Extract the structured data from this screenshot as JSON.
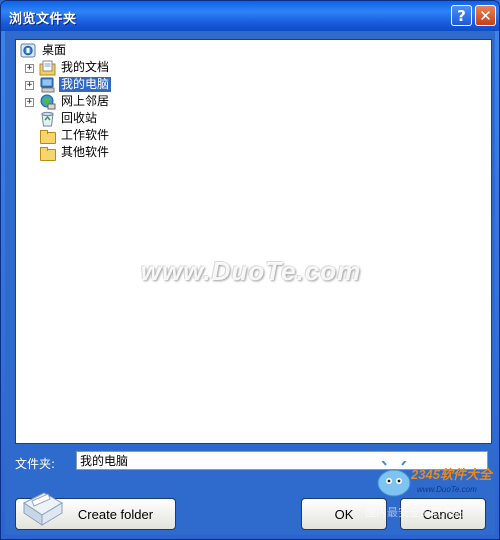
{
  "window": {
    "title": "浏览文件夹"
  },
  "titlebar": {
    "help_label": "?",
    "close_label": "✕"
  },
  "tree": {
    "items": [
      {
        "label": "桌面",
        "icon": "desktop-icon",
        "level": 0,
        "expandable": false,
        "selected": false
      },
      {
        "label": "我的文档",
        "icon": "documents-folder-icon",
        "level": 1,
        "expandable": true,
        "selected": false
      },
      {
        "label": "我的电脑",
        "icon": "computer-icon",
        "level": 1,
        "expandable": true,
        "selected": true
      },
      {
        "label": "网上邻居",
        "icon": "network-icon",
        "level": 1,
        "expandable": true,
        "selected": false
      },
      {
        "label": "回收站",
        "icon": "recycle-bin-icon",
        "level": 1,
        "expandable": false,
        "selected": false
      },
      {
        "label": "工作软件",
        "icon": "folder-icon",
        "level": 1,
        "expandable": false,
        "selected": false
      },
      {
        "label": "其他软件",
        "icon": "folder-icon",
        "level": 1,
        "expandable": false,
        "selected": false
      }
    ]
  },
  "path": {
    "label": "文件夹:",
    "value": "我的电脑"
  },
  "buttons": {
    "create_folder": "Create folder",
    "ok": "OK",
    "cancel": "Cancel"
  },
  "watermark": {
    "text": "www.DuoTe.com"
  },
  "logo": {
    "brand": "2345软件大全",
    "url": "www.DuoTe.com",
    "tagline": "国内最安全的软件站"
  },
  "colors": {
    "titlebar": "#0f63e6",
    "client": "#2f6acd",
    "selection": "#316ac5",
    "close_button": "#c4401b"
  }
}
